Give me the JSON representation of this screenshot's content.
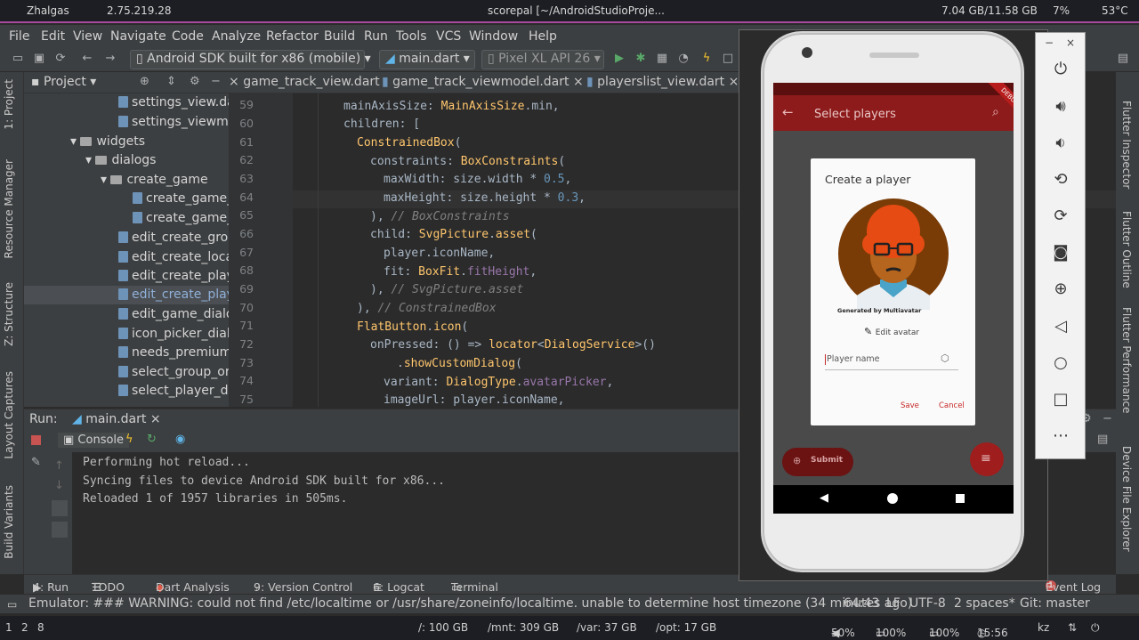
{
  "sysbar": {
    "wifi": "Zhalgas",
    "ip": "2.75.219.28",
    "title": "scorepal [~/AndroidStudioProje...",
    "memory": "7.04 GB/11.58 GB",
    "cpu": "7%",
    "temp": "53°C"
  },
  "menu": [
    "File",
    "Edit",
    "View",
    "Navigate",
    "Code",
    "Analyze",
    "Refactor",
    "Build",
    "Run",
    "Tools",
    "VCS",
    "Window",
    "Help"
  ],
  "toolbar": {
    "device": "Android SDK built for x86 (mobile)",
    "config": "main.dart",
    "avd": "Pixel XL API 26",
    "git": "Git:"
  },
  "left_tabs": [
    "1: Project",
    "Resource Manager",
    "Z: Structure",
    "Layout Captures",
    "Build Variants"
  ],
  "right_tabs": [
    "Flutter Inspector",
    "Flutter Outline",
    "Flutter Performance",
    "Device File Explorer"
  ],
  "project": {
    "label": "Project",
    "tree": [
      {
        "text": "settings_view.da",
        "type": "file"
      },
      {
        "text": "settings_viewmo",
        "type": "file"
      },
      {
        "text": "widgets",
        "type": "folder"
      },
      {
        "text": "dialogs",
        "type": "folder"
      },
      {
        "text": "create_game",
        "type": "folder"
      },
      {
        "text": "create_game_",
        "type": "file"
      },
      {
        "text": "create_game_",
        "type": "file"
      },
      {
        "text": "edit_create_grou",
        "type": "file"
      },
      {
        "text": "edit_create_locat",
        "type": "file"
      },
      {
        "text": "edit_create_play.",
        "type": "file"
      },
      {
        "text": "edit_create_playe",
        "type": "file"
      },
      {
        "text": "edit_game_dialo",
        "type": "file"
      },
      {
        "text": "icon_picker_dialc",
        "type": "file"
      },
      {
        "text": "needs_premium_",
        "type": "file"
      },
      {
        "text": "select_group_or_",
        "type": "file"
      },
      {
        "text": "select_player_dia",
        "type": "file"
      }
    ]
  },
  "editor": {
    "tabs": [
      "game_track_view.dart",
      "game_track_viewmodel.dart",
      "playerslist_view.dart"
    ],
    "line_numbers": [
      "59",
      "60",
      "61",
      "62",
      "63",
      "64",
      "65",
      "66",
      "67",
      "68",
      "69",
      "70",
      "71",
      "72",
      "73",
      "74",
      "75"
    ]
  },
  "run": {
    "label": "Run:",
    "tab": "main.dart",
    "console_tab": "Console",
    "lines": [
      "Performing hot reload...",
      "Syncing files to device Android SDK built for x86...",
      "Reloaded 1 of 1957 libraries in 505ms."
    ]
  },
  "bottom_tabs": [
    "4: Run",
    "TODO",
    "Dart Analysis",
    "9: Version Control",
    "6: Logcat",
    "Terminal"
  ],
  "event_log": "Event Log",
  "event_count": "1",
  "status": {
    "message": "Emulator: ### WARNING: could not find /etc/localtime or /usr/share/zoneinfo/localtime. unable to determine host timezone (34 minutes ago)",
    "position": "64:43",
    "line_sep": "LF",
    "encoding": "UTF-8",
    "indent": "2 spaces*",
    "git": "Git: master"
  },
  "taskbar": {
    "workspaces": [
      "1",
      "2",
      "8"
    ],
    "disks": [
      "/: 100 GB",
      "/mnt: 309 GB",
      "/var: 37 GB",
      "/opt: 17 GB"
    ],
    "volume": "50%",
    "brightness": "100%",
    "battery": "100%",
    "time": "15:56",
    "lang": "kz"
  },
  "app": {
    "appbar_title": "Select players",
    "dialog_title": "Create a player",
    "avatar_caption": "Generated by Multiavatar",
    "edit_avatar": "Edit avatar",
    "name_placeholder": "Player name",
    "save": "Save",
    "cancel": "Cancel",
    "submit": "Submit",
    "debug_banner": "DEBUG",
    "accent": "#c62828",
    "appbar_color": "#8e1b1b"
  }
}
